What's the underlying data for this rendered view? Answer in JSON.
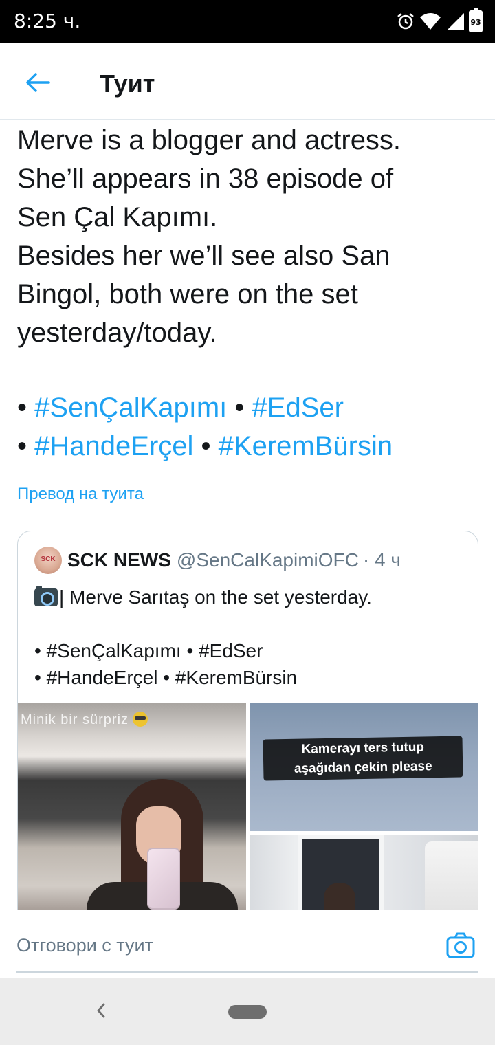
{
  "status_bar": {
    "time": "8:25 ч.",
    "battery": "93"
  },
  "header": {
    "title": "Туит"
  },
  "tweet": {
    "lines": [
      "Merve is a blogger and actress.",
      "She’ll appears in 38 episode of",
      "Sen Çal Kapımı.",
      "Besides her we’ll see also San",
      "Bingol, both were on the set",
      "yesterday/today."
    ],
    "hashtags_line1": {
      "bullet1": "•",
      "tag1": "#SenÇalKapımı",
      "bullet2": "•",
      "tag2": "#EdSer"
    },
    "hashtags_line2": {
      "bullet1": "•",
      "tag1": "#HandeErçel",
      "bullet2": "•",
      "tag2": "#KeremBürsin"
    },
    "translate_link": "Превод на туита"
  },
  "quote": {
    "avatar_text": "SCK",
    "name": "SCK NEWS",
    "handle": "@SenCalKapimiOFC",
    "time": "· 4 ч",
    "text": "| Merve Sarıtaş on the set yesterday.",
    "hashtags_line1": "• #SenÇalKapımı • #EdSer",
    "hashtags_line2": "• #HandeErçel • #KeremBürsin",
    "image1_caption": "Minik bir sürpriz",
    "image2_text_line1": "Kamerayı ters tutup",
    "image2_text_line2": "aşağıdan çekin please"
  },
  "reply": {
    "placeholder": "Отговори с туит"
  },
  "colors": {
    "accent": "#1da1f2",
    "text": "#14171a",
    "muted": "#657786",
    "border": "#ccd6dd"
  }
}
